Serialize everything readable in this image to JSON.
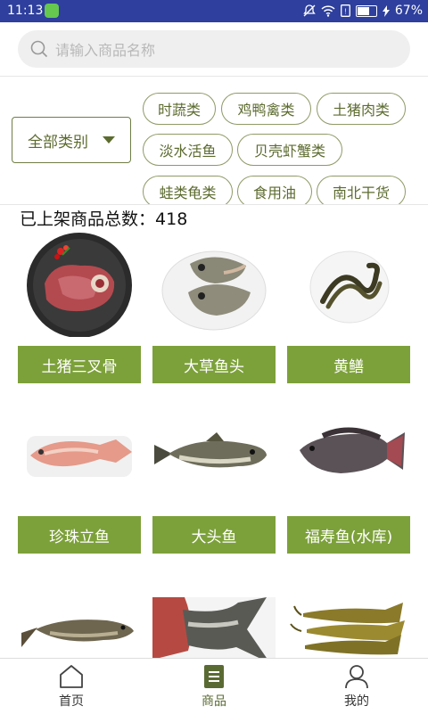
{
  "status_bar": {
    "time": "11:13",
    "battery": "67%"
  },
  "search": {
    "placeholder": "请输入商品名称",
    "value": ""
  },
  "filter": {
    "all_categories": "全部类别",
    "categories": [
      "时蔬类",
      "鸡鸭禽类",
      "土猪肉类",
      "淡水活鱼",
      "贝壳虾蟹类",
      "蛙类龟类",
      "食用油",
      "南北干货"
    ]
  },
  "product_count": {
    "label": "已上架商品总数：",
    "value": "418"
  },
  "products": [
    {
      "name": "土猪三叉骨",
      "icon": "pork-bone-image"
    },
    {
      "name": "大草鱼头",
      "icon": "fish-head-image"
    },
    {
      "name": "黄鳝",
      "icon": "eel-image"
    },
    {
      "name": "珍珠立鱼",
      "icon": "pink-fish-image"
    },
    {
      "name": "大头鱼",
      "icon": "bighead-carp-image"
    },
    {
      "name": "福寿鱼(水库)",
      "icon": "tilapia-image"
    },
    {
      "name": "",
      "icon": "grass-carp-image"
    },
    {
      "name": "",
      "icon": "fish-tail-image"
    },
    {
      "name": "",
      "icon": "yellow-catfish-image"
    }
  ],
  "tabbar": {
    "home": "首页",
    "products": "商品",
    "mine": "我的"
  },
  "colors": {
    "status_bar": "#2e3f9d",
    "accent_green": "#7da13a",
    "chip_border": "#8f9a66",
    "text_olive": "#5c6b2f"
  }
}
